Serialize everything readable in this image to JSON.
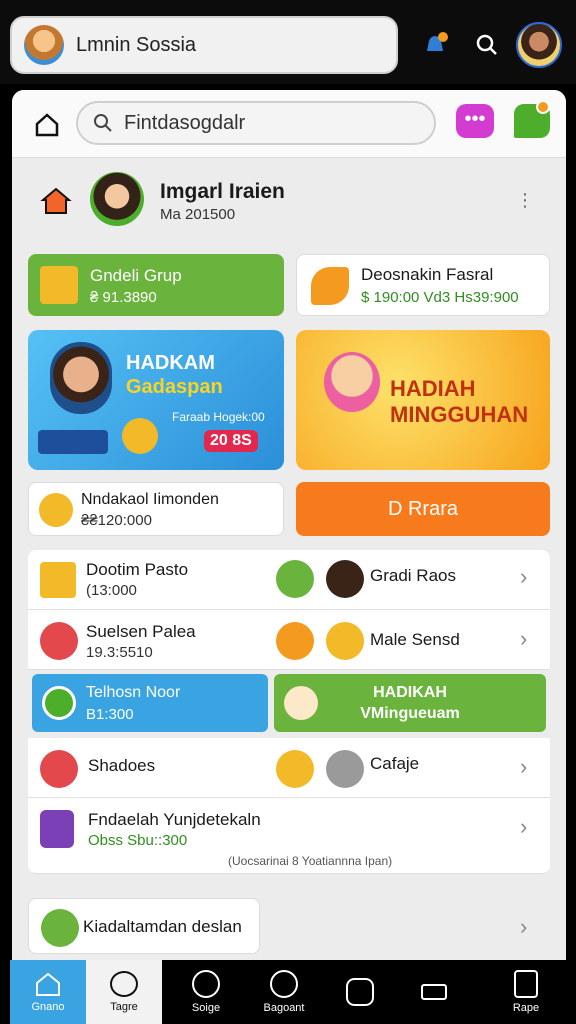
{
  "topbar": {
    "title": "Lmnin Sossia"
  },
  "search": {
    "placeholder": "Fintdasogdalr"
  },
  "profile": {
    "name": "Imgarl Iraien",
    "sub": "Ma 201500"
  },
  "cards": {
    "group": {
      "title": "Gndeli Grup",
      "value": "₴ 91.3890"
    },
    "reward": {
      "title": "Deosnakin Fasral",
      "value": "$ 190:00 Vd3 Hs39:900"
    },
    "hadiah_left": {
      "title1": "HADKAM",
      "title2": "Gadaspan",
      "caption": "Faraab Hogek:00",
      "score": "20 8S"
    },
    "hadiah_right": {
      "title1": "HADIAH",
      "title2": "MINGGUHAN"
    },
    "bonus": {
      "title": "Nndakaol Iimonden",
      "value": "₴₴120:000"
    },
    "orange_button": "D Rrara"
  },
  "list1": [
    {
      "title": "Dootim Pasto",
      "value": "(13:000",
      "right_label": "Gradi Raos"
    },
    {
      "title": "Suelsen Palea",
      "value": "19.3:5510",
      "right_label": "Male Sensd"
    }
  ],
  "split_row": {
    "left_title": "Telhosn Noor",
    "left_value": "B1:300",
    "right_title1": "HADIKAH",
    "right_title2": "VMingueuam"
  },
  "list2": [
    {
      "title": "Shadoes",
      "right_label": "Cafaje"
    },
    {
      "title": "Fndaelah Yunjdetekaln",
      "value": "Obss Sbu::300",
      "caption": "(Uocsarinai 8 Yoatiannna Ipan)"
    }
  ],
  "bottom_card": {
    "title": "Kiadaltamdan deslan"
  },
  "nav": [
    "Gnano",
    "Tagre",
    "Soige",
    "Bagoant",
    "",
    "",
    "Rape"
  ],
  "colors": {
    "green": "#6ab33c",
    "blue": "#3aa4e3",
    "orange": "#f77b1c",
    "yellow": "#f9c623"
  }
}
